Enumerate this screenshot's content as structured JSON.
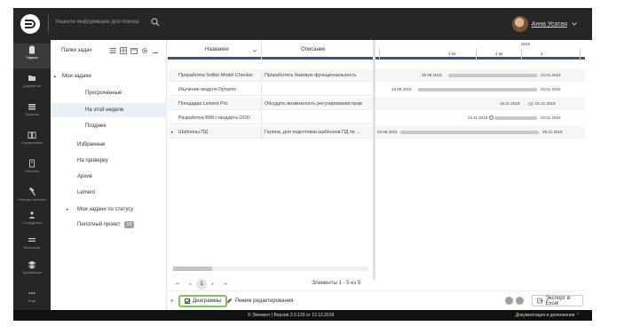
{
  "header": {
    "search_placeholder": "Укажите информацию для поиска",
    "user_name": "Анна Усатая"
  },
  "iconbar": [
    {
      "label": "Задачи",
      "icon": "clipboard-icon",
      "active": true
    },
    {
      "label": "Документы",
      "icon": "folder-icon"
    },
    {
      "label": "Проекты",
      "icon": "projects-icon"
    },
    {
      "label": "Справочники",
      "icon": "book-icon"
    },
    {
      "label": "Объекты",
      "icon": "building-icon"
    },
    {
      "label": "Реестры проекта",
      "icon": "hammer-icon"
    },
    {
      "label": "Сотрудники",
      "icon": "people-icon"
    },
    {
      "label": "Категории",
      "icon": "lines-icon"
    },
    {
      "label": "Требования",
      "icon": "stack-icon"
    },
    {
      "label": "Ещё",
      "icon": "more-icon"
    }
  ],
  "filters": {
    "title": "Папки задач",
    "items": [
      {
        "label": "Мои задачи",
        "toggle": "▴",
        "indent": 0
      },
      {
        "label": "Просроченные",
        "toggle": "",
        "indent": 1
      },
      {
        "label": "На этой неделе",
        "toggle": "",
        "indent": 1,
        "selected": true
      },
      {
        "label": "Позднее",
        "toggle": "",
        "indent": 1
      },
      {
        "label": "Избранные",
        "toggle": "",
        "indent": 0
      },
      {
        "label": "На проверку",
        "toggle": "",
        "indent": 0
      },
      {
        "label": "Архив",
        "toggle": "",
        "indent": 0
      },
      {
        "label": "Lement",
        "toggle": "",
        "indent": 0
      },
      {
        "label": "Мои задачи по статусу",
        "toggle": "▸",
        "indent": 0
      },
      {
        "label": "Пилотный проект",
        "toggle": "",
        "indent": 0,
        "badge": "14"
      }
    ]
  },
  "grid": {
    "col_name": "Название",
    "col_desc": "Описание",
    "rows": [
      {
        "name": "Проработка Solibri Model Checker",
        "desc": "Проработать базовую функциональность"
      },
      {
        "name": "Изучение модуля Dynamo",
        "desc": ""
      },
      {
        "name": "Площадка Lement Pro",
        "desc": "Обсудить возможность регулирования прав"
      },
      {
        "name": "Разработка BIM стандарта ООО",
        "desc": ""
      },
      {
        "name": "Шаблоны ПД",
        "desc": "Галина, для подготовки шаблонов ПД по …",
        "expander": "▸"
      }
    ]
  },
  "gantt": {
    "year": "2019",
    "quarters": [
      "3 кв",
      "4 кв",
      "1"
    ],
    "rows": [
      {
        "start": "29.08.2018",
        "end": "23.01.2019"
      },
      {
        "start": "13.09.2018",
        "end": "23.01.2019"
      },
      {
        "start": "15.01.2019",
        "end": "01.01.2019"
      },
      {
        "start": "13.11.2018",
        "end": "23.01.2019"
      },
      {
        "start": "03.08.2018",
        "end": "29.01.2019"
      }
    ]
  },
  "pager": {
    "first": "⏮",
    "prev": "◂",
    "page": "1",
    "next": "▸",
    "last": "⏭",
    "info": "Элементы 1 - 5 из 5"
  },
  "toolbar": {
    "add": "+",
    "diagrams_label": "Диаграммы",
    "edit_mode_label": "Режим редактирования",
    "export_label": "Экспорт в Excel"
  },
  "footer": {
    "text": "© Элемент | Версия 2.0.120 от 13.12.2018",
    "doc": "Документация и дополнения ⌃"
  }
}
